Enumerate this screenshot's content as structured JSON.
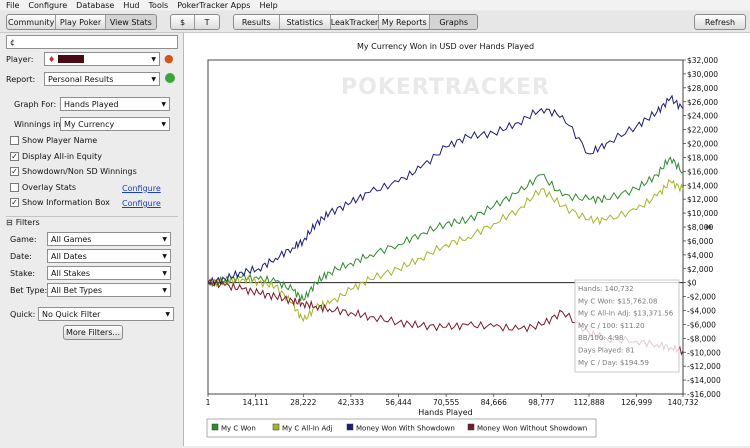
{
  "menu": [
    "File",
    "Configure",
    "Database",
    "Hud",
    "Tools",
    "PokerTracker Apps",
    "Help"
  ],
  "toolbar": {
    "nav": [
      "Community",
      "Play Poker",
      "View Stats"
    ],
    "currency": [
      "$",
      "T"
    ],
    "views": [
      "Results",
      "Statistics",
      "LeakTracker",
      "My Reports",
      "Graphs"
    ],
    "refresh": "Refresh"
  },
  "left": {
    "filter_value": "¢",
    "player_label": "Player:",
    "report_label": "Report:",
    "report_value": "Personal Results",
    "graph_for_label": "Graph For:",
    "graph_for_value": "Hands Played",
    "winnings_label": "Winnings in:",
    "winnings_value": "My Currency",
    "checks": [
      {
        "label": "Show Player Name",
        "checked": false
      },
      {
        "label": "Display All-in Equity",
        "checked": true
      },
      {
        "label": "Showdown/Non SD Winnings",
        "checked": true
      },
      {
        "label": "Overlay Stats",
        "checked": false,
        "link": "Configure"
      },
      {
        "label": "Show Information Box",
        "checked": true,
        "link": "Configure"
      }
    ],
    "filters_header": "Filters",
    "filters": [
      {
        "label": "Game:",
        "value": "All Games"
      },
      {
        "label": "Date:",
        "value": "All Dates"
      },
      {
        "label": "Stake:",
        "value": "All Stakes"
      },
      {
        "label": "Bet Type:",
        "value": "All Bet Types"
      }
    ],
    "quick_label": "Quick:",
    "quick_value": "No Quick Filter",
    "more_filters": "More Filters..."
  },
  "chart_data": {
    "type": "line",
    "title": "My Currency Won in USD over Hands Played",
    "watermark": "POKERTRACKER",
    "xlabel": "Hands Played",
    "ylabel": "$",
    "xlim": [
      1,
      140732
    ],
    "ylim": [
      -16000,
      32000
    ],
    "xticks": [
      1,
      14111,
      28222,
      42333,
      56444,
      70555,
      84666,
      98777,
      112888,
      126999,
      140732
    ],
    "xtick_labels": [
      "1",
      "14,111",
      "28,222",
      "42,333",
      "56,444",
      "70,555",
      "84,666",
      "98,777",
      "112,888",
      "126,999",
      "140,732"
    ],
    "yticks": [
      32000,
      30000,
      28000,
      26000,
      24000,
      22000,
      20000,
      18000,
      16000,
      14000,
      12000,
      10000,
      8000,
      6000,
      4000,
      2000,
      0,
      -2000,
      -4000,
      -6000,
      -8000,
      -10000,
      -12000,
      -14000,
      -16000
    ],
    "ytick_labels": [
      "$32,000",
      "$30,000",
      "$28,000",
      "$26,000",
      "$24,000",
      "$22,000",
      "$20,000",
      "$18,000",
      "$16,000",
      "$14,000",
      "$12,000",
      "$10,000",
      "$8,000",
      "$6,000",
      "$4,000",
      "$2,000",
      "$0",
      "-$2,000",
      "-$4,000",
      "-$6,000",
      "-$8,000",
      "-$10,000",
      "-$12,000",
      "-$14,000",
      "-$16,000"
    ],
    "x": [
      1,
      5000,
      10000,
      15000,
      20000,
      25000,
      28222,
      32000,
      36000,
      42333,
      48000,
      56444,
      63000,
      70555,
      77000,
      84666,
      92000,
      98777,
      105000,
      112888,
      118000,
      126999,
      133000,
      137000,
      140732
    ],
    "series": [
      {
        "name": "My C Won",
        "color": "#2e8b2e",
        "values": [
          0,
          300,
          800,
          500,
          200,
          -1000,
          -2500,
          0,
          1500,
          2800,
          4000,
          5500,
          7000,
          8500,
          9000,
          11000,
          13000,
          15500,
          12500,
          12000,
          12000,
          13500,
          15500,
          18000,
          15800
        ]
      },
      {
        "name": "My C All-In Adj",
        "color": "#a8b42a",
        "values": [
          0,
          200,
          500,
          100,
          -500,
          -3000,
          -5500,
          -3500,
          -3000,
          -1000,
          500,
          2000,
          3500,
          5500,
          6500,
          8500,
          10500,
          13500,
          11000,
          9000,
          9000,
          10500,
          12500,
          14500,
          13400
        ]
      },
      {
        "name": "Money Won With Showdown",
        "color": "#1c1c7c",
        "values": [
          0,
          500,
          1500,
          2000,
          3500,
          5000,
          6000,
          8500,
          10000,
          11500,
          13000,
          14500,
          16500,
          19500,
          21000,
          21500,
          23000,
          25000,
          24000,
          18500,
          20000,
          22500,
          24500,
          26500,
          25000
        ]
      },
      {
        "name": "Money Won Without Showdown",
        "color": "#7a1c2c",
        "values": [
          0,
          -400,
          -900,
          -1500,
          -2000,
          -2600,
          -3000,
          -3400,
          -3800,
          -4300,
          -4900,
          -5700,
          -6200,
          -6400,
          -6100,
          -6300,
          -6700,
          -6100,
          -4200,
          -7200,
          -8000,
          -8400,
          -8900,
          -9300,
          -9800
        ]
      }
    ],
    "info_box": [
      "Hands: 140,732",
      "My C Won: $15,762.08",
      "My C All-In Adj: $13,371.56",
      "My C / 100: $11.20",
      "BB/100: 4.98",
      "Days Played: 81",
      "My C / Day: $194.59"
    ]
  }
}
